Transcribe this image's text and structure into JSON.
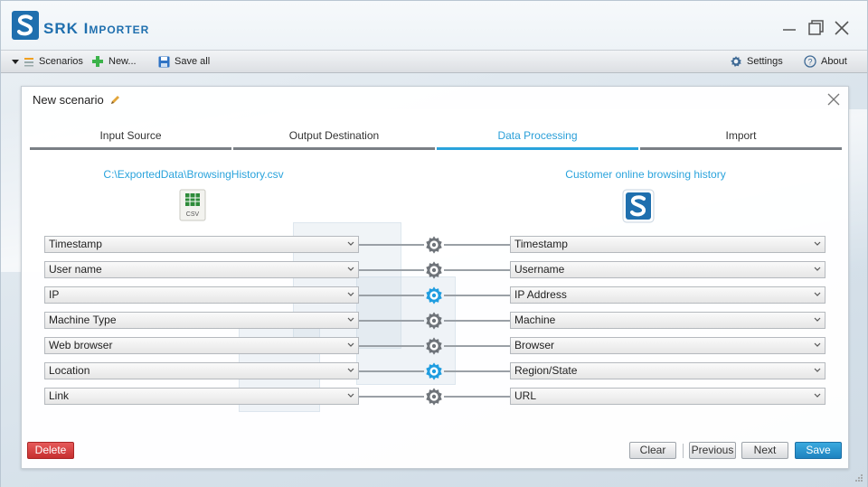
{
  "app": {
    "title": "SRK Importer"
  },
  "toolbar": {
    "scenarios_label": "Scenarios",
    "new_label": "New...",
    "save_all_label": "Save all",
    "settings_label": "Settings",
    "about_label": "About"
  },
  "dialog": {
    "title": "New scenario",
    "tabs": [
      {
        "label": "Input Source",
        "active": false
      },
      {
        "label": "Output Destination",
        "active": false
      },
      {
        "label": "Data Processing",
        "active": true
      },
      {
        "label": "Import",
        "active": false
      }
    ],
    "source_path": "C:\\ExportedData\\BrowsingHistory.csv",
    "source_icon_text": "CSV",
    "destination_name": "Customer online browsing history",
    "mappings": [
      {
        "source": "Timestamp",
        "target": "Timestamp",
        "gear": "inactive"
      },
      {
        "source": "User name",
        "target": "Username",
        "gear": "inactive"
      },
      {
        "source": "IP",
        "target": "IP Address",
        "gear": "active"
      },
      {
        "source": "Machine Type",
        "target": "Machine",
        "gear": "inactive"
      },
      {
        "source": "Web browser",
        "target": "Browser",
        "gear": "inactive"
      },
      {
        "source": "Location",
        "target": "Region/State",
        "gear": "active"
      },
      {
        "source": "Link",
        "target": "URL",
        "gear": "inactive"
      }
    ],
    "buttons": {
      "delete": "Delete",
      "clear": "Clear",
      "previous": "Previous",
      "next": "Next",
      "save": "Save"
    }
  },
  "colors": {
    "accent": "#29a3dc",
    "gear_active": "#1f9de0",
    "gear_inactive": "#6f747a",
    "delete": "#d03a3a",
    "save": "#1e83c0"
  }
}
